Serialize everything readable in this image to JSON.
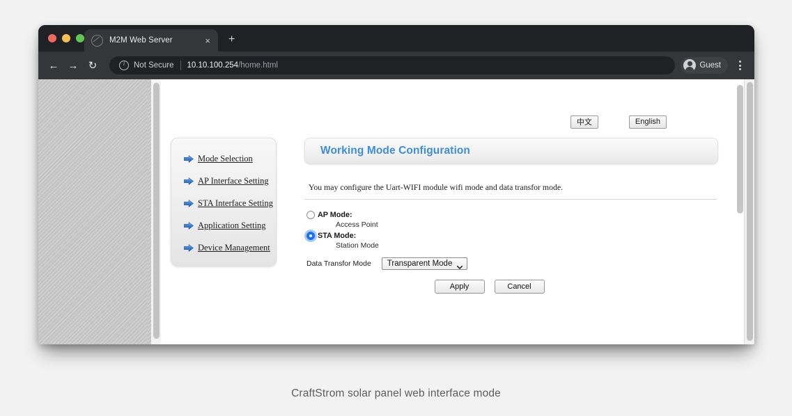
{
  "browser": {
    "tab": {
      "title": "M2M Web Server",
      "favicon": "globe-icon",
      "close_label": "×"
    },
    "new_tab_label": "+",
    "nav": {
      "back": "←",
      "forward": "→",
      "reload": "↻"
    },
    "omnibox": {
      "security_label": "Not Secure",
      "url_host": "10.10.100.254",
      "url_path": "/home.html"
    },
    "profile": {
      "label": "Guest",
      "avatar_icon": "person-icon"
    },
    "menu_icon": "three-dots-icon",
    "traffic_lights": {
      "close": "#ed6a5f",
      "minimize": "#f4bf50",
      "zoom": "#61c554"
    }
  },
  "page": {
    "languages": {
      "chinese": "中文",
      "english": "English"
    },
    "sidebar": {
      "items": [
        {
          "label": "Mode Selection",
          "icon": "blue-arrow-icon"
        },
        {
          "label": "AP Interface Setting",
          "icon": "blue-arrow-icon"
        },
        {
          "label": "STA Interface Setting",
          "icon": "blue-arrow-icon"
        },
        {
          "label": "Application Setting",
          "icon": "blue-arrow-icon"
        },
        {
          "label": "Device Management",
          "icon": "blue-arrow-icon"
        }
      ]
    },
    "panel": {
      "title": "Working Mode Configuration",
      "title_color": "#3c8ddc",
      "description": "You may configure the Uart-WIFI module wifi mode and data transfor mode.",
      "modes": [
        {
          "label": "AP Mode:",
          "sublabel": "Access Point",
          "selected": false
        },
        {
          "label": "STA Mode:",
          "sublabel": "Station Mode",
          "selected": true
        }
      ],
      "transfer": {
        "label": "Data Transfor Mode",
        "value": "Transparent Mode",
        "options": [
          "Transparent Mode"
        ],
        "chevron_icon": "chevron-down-icon"
      },
      "buttons": {
        "apply": "Apply",
        "cancel": "Cancel"
      }
    }
  },
  "caption": "CraftStrom solar panel web interface mode"
}
